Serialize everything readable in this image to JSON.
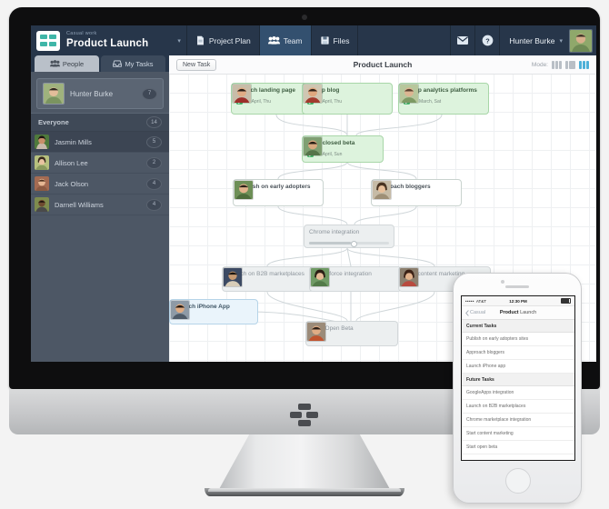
{
  "app": {
    "brand": {
      "sub": "Casual work",
      "name": "Product Launch",
      "caret": "▾"
    },
    "nav": [
      {
        "label": "Project Plan",
        "icon": "document-icon",
        "active": false
      },
      {
        "label": "Team",
        "icon": "people-icon",
        "active": true
      },
      {
        "label": "Files",
        "icon": "floppy-icon",
        "active": false
      }
    ],
    "topright": {
      "mail_icon": "mail-icon",
      "help_icon": "help-icon",
      "user_name": "Hunter Burke",
      "caret": "▾"
    }
  },
  "sidebar": {
    "tabs": [
      {
        "label": "People",
        "icon": "people-icon",
        "active": true
      },
      {
        "label": "My Tasks",
        "icon": "inbox-icon",
        "active": false
      }
    ],
    "me": {
      "name": "Hunter Burke",
      "count": "7"
    },
    "group": {
      "label": "Everyone",
      "count": "14"
    },
    "people": [
      {
        "name": "Jasmin Mills",
        "count": "5",
        "selected": true
      },
      {
        "name": "Allison Lee",
        "count": "2",
        "selected": false
      },
      {
        "name": "Jack Olson",
        "count": "4",
        "selected": false
      },
      {
        "name": "Darnell Williams",
        "count": "4",
        "selected": false
      }
    ]
  },
  "canvas": {
    "new_task_label": "New Task",
    "title": "Product Launch",
    "mode_label": "Mode:",
    "modes": [
      {
        "name": "columns-view",
        "active": false
      },
      {
        "name": "board-view",
        "active": false
      },
      {
        "name": "graph-view",
        "active": true
      }
    ],
    "nodes": [
      {
        "id": "launch-landing-page",
        "title": "Launch landing page",
        "date": "30 April, Thu",
        "style": "green"
      },
      {
        "id": "set-up-blog",
        "title": "Set up blog",
        "date": "30 April, Thu",
        "style": "green"
      },
      {
        "id": "set-up-analytics",
        "title": "Set up analytics platforms",
        "date": "28 March, Sat",
        "style": "green"
      },
      {
        "id": "start-closed-beta",
        "title": "Start closed beta",
        "date": "12 April, Sun",
        "style": "green"
      },
      {
        "id": "publish-early-adopters",
        "title": "Publish on early adopters sites",
        "date": "",
        "style": "white"
      },
      {
        "id": "approach-bloggers",
        "title": "Approach bloggers",
        "date": "",
        "style": "white"
      },
      {
        "id": "chrome-integration",
        "title": "Chrome integration",
        "date": "",
        "style": "grey"
      },
      {
        "id": "launch-b2b",
        "title": "Launch on B2B marketplaces",
        "date": "",
        "style": "grey"
      },
      {
        "id": "salesforce-integration",
        "title": "Salesforce integration",
        "date": "",
        "style": "grey"
      },
      {
        "id": "start-content-marketing",
        "title": "Start content marketing",
        "date": "",
        "style": "grey"
      },
      {
        "id": "launch-iphone-app",
        "title": "Launch iPhone App",
        "date": "",
        "style": "blue"
      },
      {
        "id": "start-open-beta",
        "title": "Start Open Beta",
        "date": "",
        "style": "grey"
      }
    ]
  },
  "phone": {
    "status": {
      "signal": "•••••",
      "carrier": "AT&T",
      "time": "12:30 PM"
    },
    "nav": {
      "back": "Casual",
      "title_light": "Product ",
      "title_bold": "Launch"
    },
    "sections": [
      {
        "title": "Current Tasks",
        "items": [
          "Publish on early adopters sites",
          "Approach bloggers",
          "Launch iPhone app"
        ]
      },
      {
        "title": "Future Tasks",
        "items": [
          "GoogleApps integration",
          "Launch on B2B marketplaces",
          "Chrome marketplace integration",
          "Start content marketing",
          "Start open beta"
        ]
      }
    ]
  },
  "colors": {
    "topbar": "#27364a",
    "sidebar": "#4d5765",
    "accent": "#4db0d8",
    "node_green": "#ddf3dd",
    "node_blue": "#eaf4fb"
  }
}
